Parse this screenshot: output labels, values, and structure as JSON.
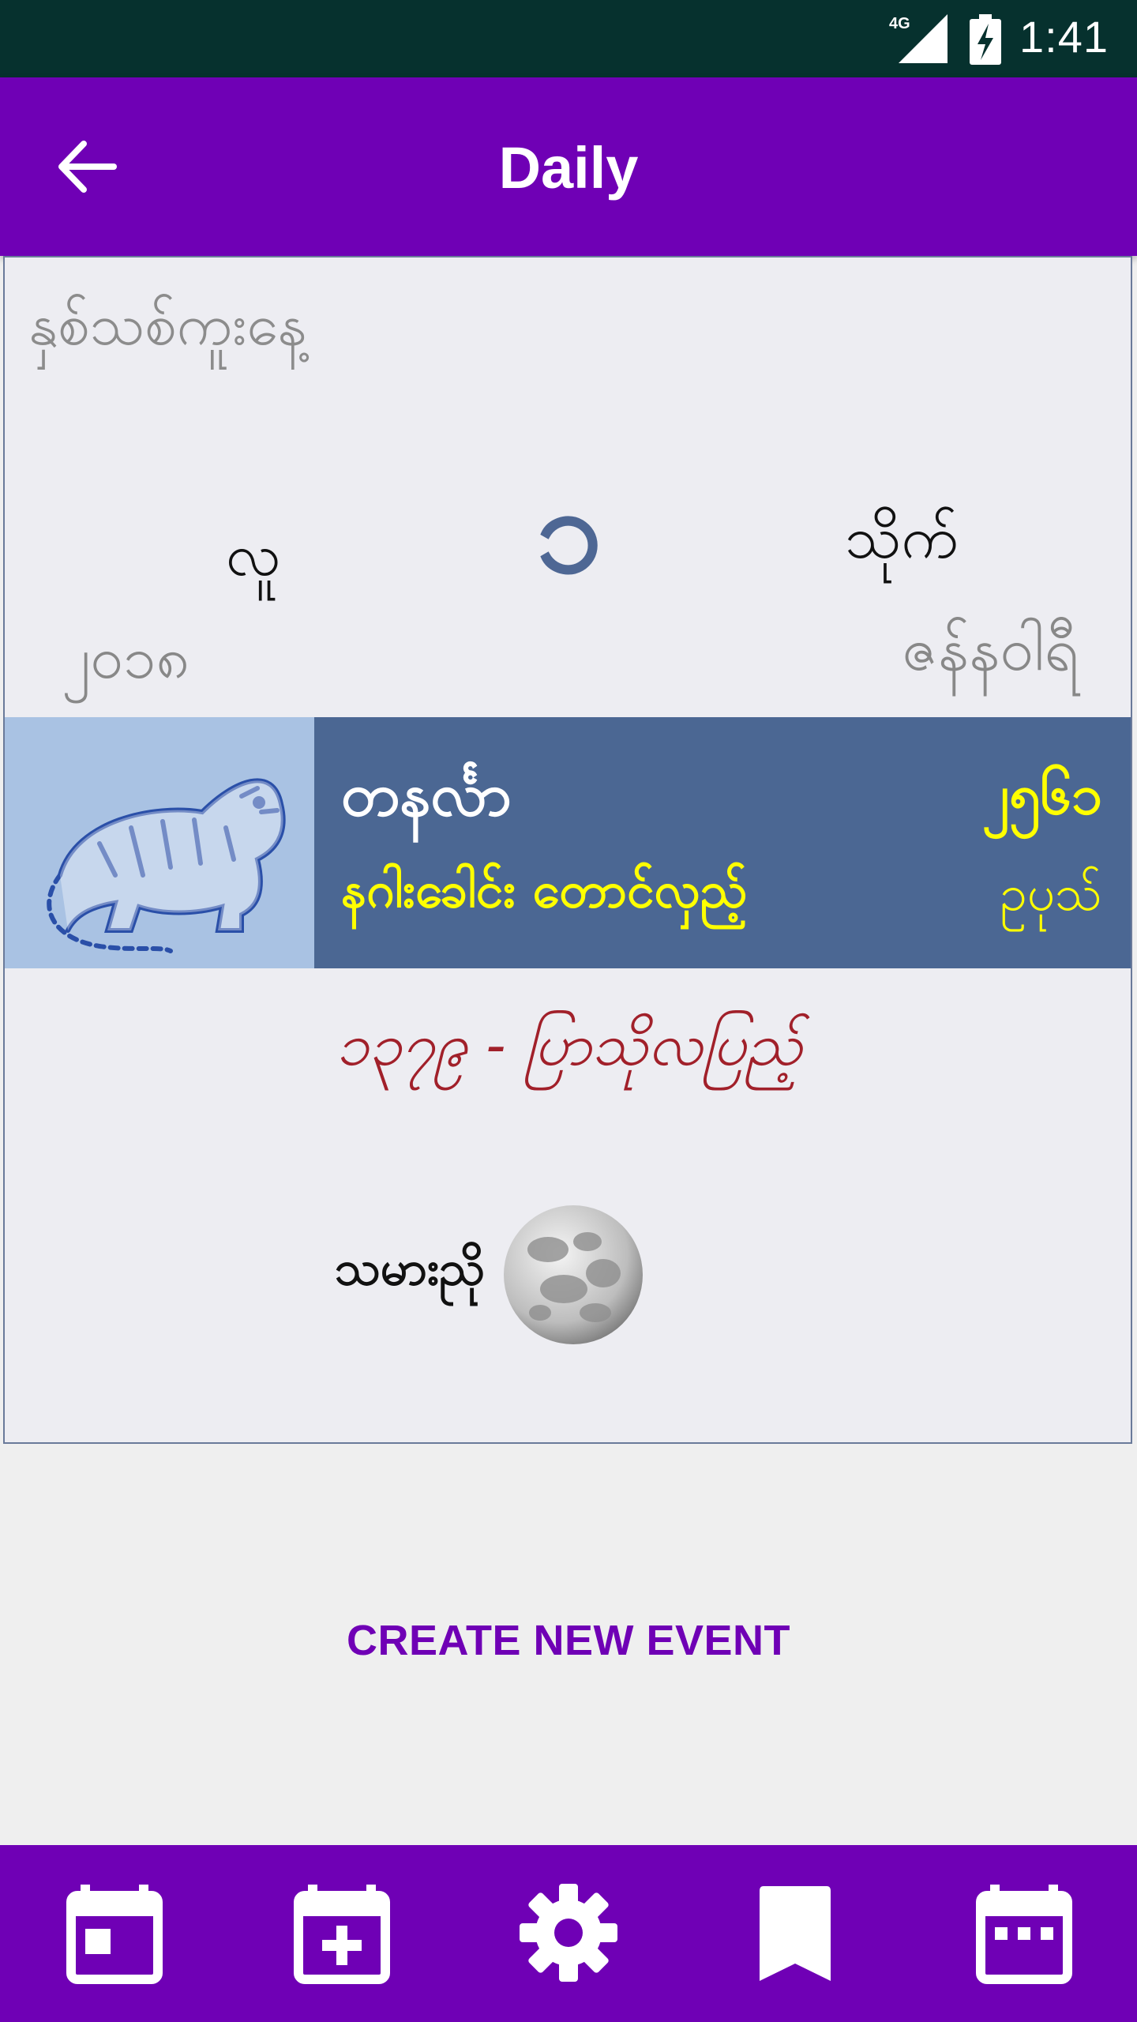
{
  "status_bar": {
    "time": "1:41",
    "network": "4G",
    "icons": [
      "signal-icon",
      "battery-charging-icon"
    ]
  },
  "app_bar": {
    "title": "Daily",
    "back_icon": "arrow-back-icon"
  },
  "date_card": {
    "header": "နှစ်သစ်ကူးနေ့",
    "day_number": "၁",
    "weekday": "လူ",
    "month_short": "သိုက်",
    "year": "၂၀၁၈",
    "month_name": "ဇန်နဝါရီ",
    "zodiac": {
      "image_icon": "tiger-icon",
      "name": "တနင်္လာ",
      "subtitle": "နဂါးခေါင်း တောင်လှည့်",
      "right_top": "၂၅၆၁",
      "right_bottom": "ဥပုသ်"
    },
    "festival": "၁၃၇၉ - ပြာသိုလပြည့်",
    "moon": {
      "label": "သမားညို",
      "icon": "full-moon-icon"
    }
  },
  "actions": {
    "create_event": "CREATE NEW EVENT"
  },
  "bottom_nav": {
    "items": [
      {
        "icon": "calendar-day-icon"
      },
      {
        "icon": "calendar-add-icon"
      },
      {
        "icon": "gear-icon"
      },
      {
        "icon": "bookmark-icon"
      },
      {
        "icon": "calendar-month-icon"
      }
    ]
  },
  "colors": {
    "primary": "#6f00b5",
    "status_bar": "#06312e",
    "band": "#4b6793",
    "accent_yellow": "#ffff00",
    "festival_red": "#a1202a"
  }
}
